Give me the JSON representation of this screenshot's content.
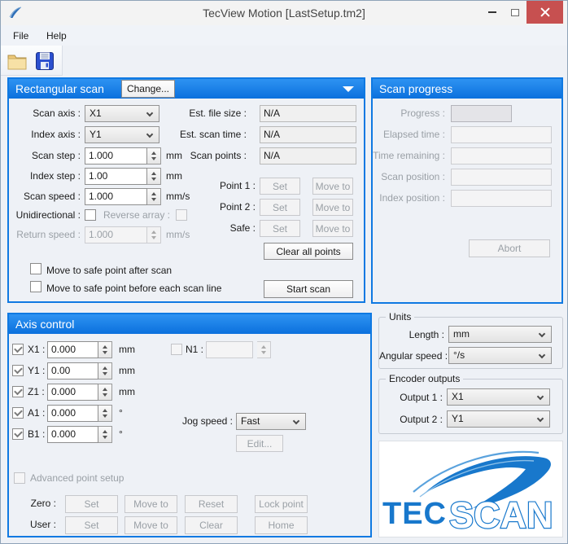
{
  "window": {
    "title": "TecView Motion [LastSetup.tm2]"
  },
  "menu": {
    "file": "File",
    "help": "Help"
  },
  "rect_scan": {
    "title": "Rectangular scan",
    "change_button": "Change...",
    "scan_axis": {
      "label": "Scan axis :",
      "value": "X1"
    },
    "index_axis": {
      "label": "Index axis :",
      "value": "Y1"
    },
    "scan_step": {
      "label": "Scan step :",
      "value": "1.000",
      "unit": "mm"
    },
    "index_step": {
      "label": "Index step :",
      "value": "1.00",
      "unit": "mm"
    },
    "scan_speed": {
      "label": "Scan speed :",
      "value": "1.000",
      "unit": "mm/s"
    },
    "unidirectional": {
      "label": "Unidirectional :",
      "checked": false
    },
    "reverse_array": {
      "label": "Reverse array :",
      "checked": false
    },
    "return_speed": {
      "label": "Return speed :",
      "value": "1.000",
      "unit": "mm/s"
    },
    "est_file_size": {
      "label": "Est. file size :",
      "value": "N/A"
    },
    "est_scan_time": {
      "label": "Est. scan time :",
      "value": "N/A"
    },
    "scan_points": {
      "label": "Scan points :",
      "value": "N/A"
    },
    "points": [
      {
        "label": "Point 1 :",
        "set": "Set",
        "move": "Move to"
      },
      {
        "label": "Point 2 :",
        "set": "Set",
        "move": "Move to"
      },
      {
        "label": "Safe :",
        "set": "Set",
        "move": "Move to"
      }
    ],
    "clear_all_button": "Clear all points",
    "safe_after": {
      "label": "Move to safe point after scan",
      "checked": false
    },
    "safe_before": {
      "label": "Move to safe point before each scan line",
      "checked": false
    },
    "start_button": "Start scan"
  },
  "scan_progress": {
    "title": "Scan progress",
    "progress": {
      "label": "Progress :",
      "value": ""
    },
    "elapsed": {
      "label": "Elapsed time :",
      "value": ""
    },
    "remaining": {
      "label": "Time remaining :",
      "value": ""
    },
    "scan_pos": {
      "label": "Scan position :",
      "value": ""
    },
    "index_pos": {
      "label": "Index position :",
      "value": ""
    },
    "abort_button": "Abort"
  },
  "axis_control": {
    "title": "Axis control",
    "axes": [
      {
        "label": "X1 :",
        "value": "0.000",
        "unit": "mm",
        "checked": true
      },
      {
        "label": "Y1 :",
        "value": "0.00",
        "unit": "mm",
        "checked": true
      },
      {
        "label": "Z1 :",
        "value": "0.000",
        "unit": "mm",
        "checked": true
      },
      {
        "label": "A1 :",
        "value": "0.000",
        "unit": "°",
        "checked": true
      },
      {
        "label": "B1 :",
        "value": "0.000",
        "unit": "°",
        "checked": true
      }
    ],
    "n1": {
      "label": "N1 :",
      "value": "",
      "checked": false
    },
    "jog_speed": {
      "label": "Jog speed :",
      "value": "Fast"
    },
    "edit_button": "Edit...",
    "advanced": {
      "label": "Advanced point setup",
      "checked": false
    },
    "zero": {
      "label": "Zero :",
      "buttons": [
        "Set",
        "Move to",
        "Reset",
        "Lock point"
      ]
    },
    "user": {
      "label": "User :",
      "buttons": [
        "Set",
        "Move to",
        "Clear",
        "Home"
      ]
    }
  },
  "units": {
    "title": "Units",
    "length": {
      "label": "Length :",
      "value": "mm"
    },
    "angular_speed": {
      "label": "Angular speed :",
      "value": "°/s"
    }
  },
  "encoder": {
    "title": "Encoder outputs",
    "output1": {
      "label": "Output 1 :",
      "value": "X1"
    },
    "output2": {
      "label": "Output 2 :",
      "value": "Y1"
    }
  },
  "logo": {
    "tec": "TEC",
    "scan": "SCAN"
  },
  "colors": {
    "accent_blue": "#0f79e2",
    "close_red": "#c75050",
    "logo_blue": "#1878cc"
  }
}
